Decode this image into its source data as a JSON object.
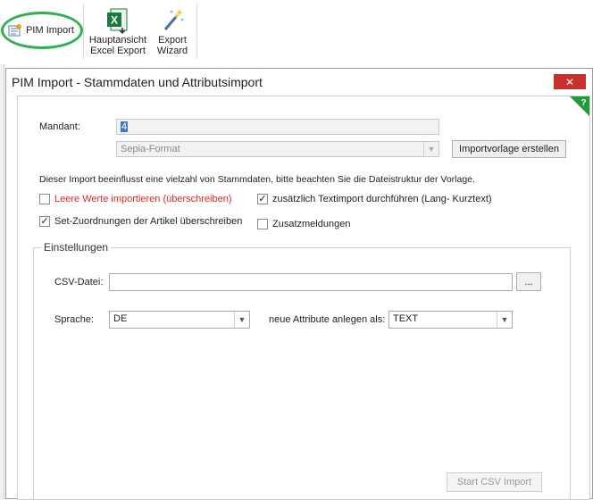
{
  "ribbon": {
    "pim_import": "PIM Import",
    "excel_export_line1": "Hauptansicht",
    "excel_export_line2": "Excel Export",
    "export_wizard_line1": "Export",
    "export_wizard_line2": "Wizard"
  },
  "dialog": {
    "title": "PIM Import - Stammdaten und Attributsimport",
    "close": "✕",
    "help": "?",
    "mandant_label": "Mandant:",
    "mandant_value": "4",
    "format_value": "Sepia-Format",
    "importvorlage_button": "Importvorlage erstellen",
    "info_text": "Dieser Import beeinflusst eine vielzahl von Stammdaten, bitte beachten Sie die Dateistruktur der Vorlage.",
    "checkboxes": {
      "leere_werte": {
        "label": "Leere Werte importieren (überschreiben)",
        "checked": false
      },
      "textimport": {
        "label": "zusätzlich Textimport durchführen (Lang- Kurztext)",
        "checked": true
      },
      "set_zuordnungen": {
        "label": "Set-Zuordnungen der Artikel überschreiben",
        "checked": true
      },
      "zusatzmeldungen": {
        "label": "Zusatzmeldungen",
        "checked": false
      }
    },
    "einstellungen": {
      "legend": "Einstellungen",
      "csv_label": "CSV-Datei:",
      "csv_value": "",
      "browse_button": "...",
      "sprache_label": "Sprache:",
      "sprache_value": "DE",
      "attribute_label": "neue Attribute anlegen als:",
      "attribute_value": "TEXT"
    },
    "start_button": "Start CSV Import"
  },
  "colors": {
    "highlight": "#2fb14f",
    "close_bg": "#c9302c",
    "warning_text": "#d42a2a",
    "help_corner": "#1e9c3c"
  }
}
